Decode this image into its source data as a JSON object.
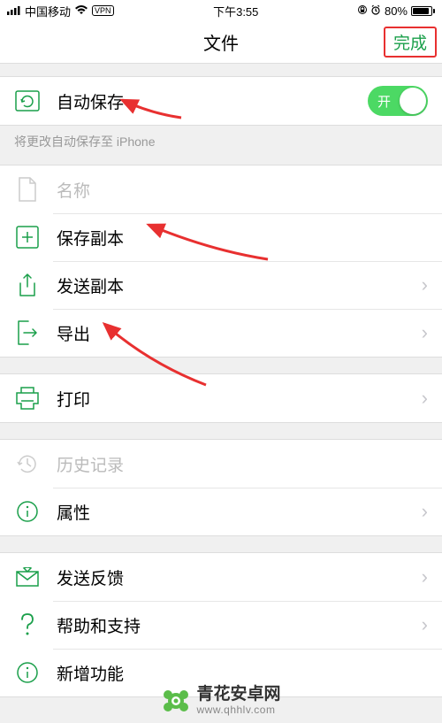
{
  "status": {
    "carrier": "中国移动",
    "vpn": "VPN",
    "time": "下午3:55",
    "battery_pct": "80%"
  },
  "nav": {
    "title": "文件",
    "done": "完成"
  },
  "autosave": {
    "label": "自动保存",
    "toggle_text": "开",
    "footer": "将更改自动保存至 iPhone"
  },
  "rows": {
    "name": "名称",
    "save_copy": "保存副本",
    "send_copy": "发送副本",
    "export": "导出",
    "print": "打印",
    "history": "历史记录",
    "properties": "属性",
    "feedback": "发送反馈",
    "help": "帮助和支持",
    "whats_new": "新增功能"
  },
  "watermark": {
    "title": "青花安卓网",
    "url": "www.qhhlv.com"
  },
  "colors": {
    "accent": "#1a9f4a",
    "toggle": "#4cd964",
    "highlight": "#e83030"
  }
}
